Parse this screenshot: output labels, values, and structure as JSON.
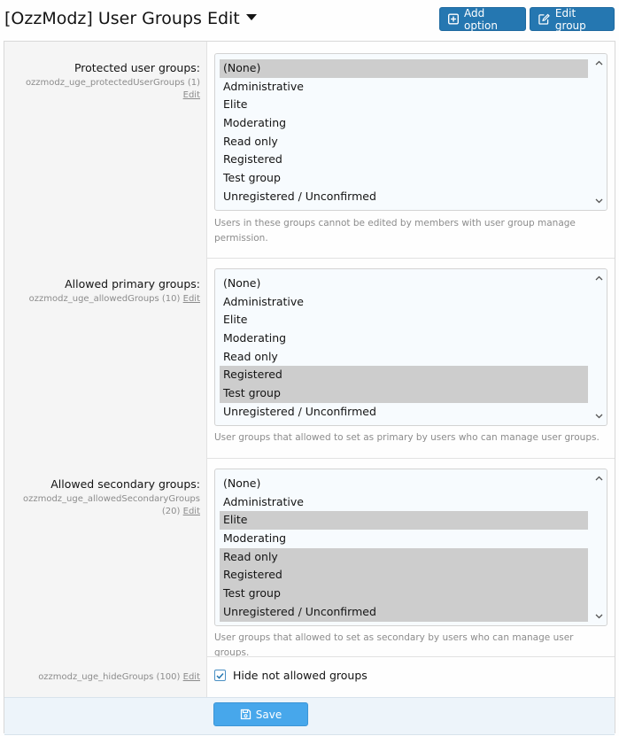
{
  "header": {
    "title": "[OzzModz] User Groups Edit",
    "add_option_label": "Add option",
    "edit_group_label": "Edit group"
  },
  "fields": {
    "protected": {
      "label": "Protected user groups:",
      "option_id": "ozzmodz_uge_protectedUserGroups (1)",
      "edit_link": "Edit",
      "explain": "Users in these groups cannot be edited by members with user group manage permission.",
      "options": [
        "(None)",
        "Administrative",
        "Elite",
        "Moderating",
        "Read only",
        "Registered",
        "Test group",
        "Unregistered / Unconfirmed"
      ],
      "selected": [
        "(None)"
      ]
    },
    "primary": {
      "label": "Allowed primary groups:",
      "option_id": "ozzmodz_uge_allowedGroups (10)",
      "edit_link": "Edit",
      "explain": "User groups that allowed to set as primary by users who can manage user groups.",
      "options": [
        "(None)",
        "Administrative",
        "Elite",
        "Moderating",
        "Read only",
        "Registered",
        "Test group",
        "Unregistered / Unconfirmed"
      ],
      "selected": [
        "Registered",
        "Test group"
      ]
    },
    "secondary": {
      "label": "Allowed secondary groups:",
      "option_id_line1": "ozzmodz_uge_allowedSecondaryGroups",
      "option_id_line2": "(20)",
      "edit_link": "Edit",
      "explain": "User groups that allowed to set as secondary by users who can manage user groups.",
      "options": [
        "(None)",
        "Administrative",
        "Elite",
        "Moderating",
        "Read only",
        "Registered",
        "Test group",
        "Unregistered / Unconfirmed"
      ],
      "selected": [
        "Elite",
        "Read only",
        "Registered",
        "Test group",
        "Unregistered / Unconfirmed"
      ]
    },
    "hide": {
      "option_id": "ozzmodz_uge_hideGroups (100)",
      "edit_link": "Edit",
      "checkbox_label": "Hide not allowed groups",
      "checked": true
    }
  },
  "submit": {
    "save_label": "Save"
  },
  "colors": {
    "primary_button": "#2577b1",
    "save_button": "#47a7eb",
    "selected_option": "#cdcdcd"
  }
}
